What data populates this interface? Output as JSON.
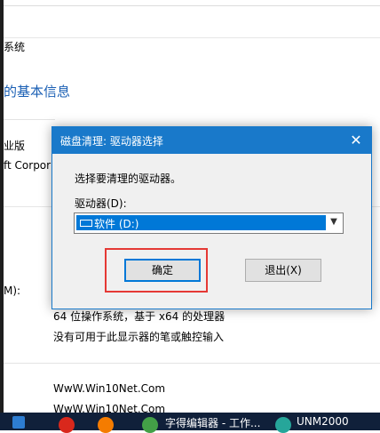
{
  "background": {
    "breadcrumb_fragment": "系统",
    "section_title": "的基本信息",
    "edition_fragment": "业版",
    "publisher_fragment": "ft Corpor",
    "ram_fragment": "M):",
    "system_type": "64 位操作系统，基于 x64 的处理器",
    "pen_touch": "没有可用于此显示器的笔或触控输入",
    "watermark_1": "WwW.Win10Net.Com",
    "watermark_2": "WwW.Win10Net.Com",
    "accent_color": "#1a5fb4"
  },
  "dialog": {
    "title": "磁盘清理: 驱动器选择",
    "close_glyph": "✕",
    "prompt": "选择要清理的驱动器。",
    "drive_label": "驱动器(D):",
    "drive_selected": "软件 (D:)",
    "ok_label": "确定",
    "exit_label": "退出(X)"
  },
  "taskbar": {
    "item_text_1": "字得编辑器 - 工作...",
    "item_text_2": "UNM2000"
  }
}
